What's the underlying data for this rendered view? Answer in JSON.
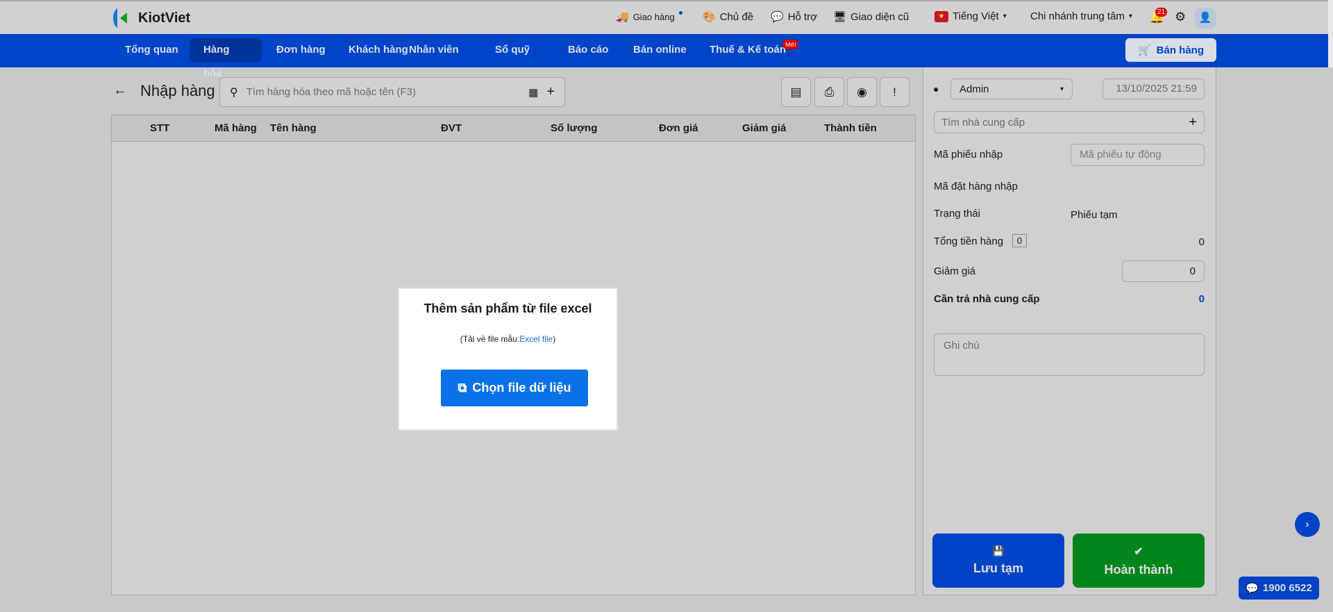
{
  "header": {
    "brand": "KiotViet",
    "delivery": "Giao hàng",
    "theme": "Chủ đề",
    "support": "Hỗ trợ",
    "old_ui": "Giao diện cũ",
    "language": "Tiếng Việt",
    "branch": "Chi nhánh trung tâm",
    "notification_count": "21"
  },
  "nav": {
    "items": [
      {
        "label": "Tổng quan"
      },
      {
        "label": "Hàng hóa"
      },
      {
        "label": "Đơn hàng"
      },
      {
        "label": "Khách hàng"
      },
      {
        "label": "Nhân viên"
      },
      {
        "label": "Sổ quỹ"
      },
      {
        "label": "Báo cáo"
      },
      {
        "label": "Bán online"
      },
      {
        "label": "Thuế & Kế toán"
      }
    ],
    "new_badge": "Mới",
    "sell_button": "Bán hàng"
  },
  "page": {
    "title": "Nhập hàng",
    "search_placeholder": "Tìm hàng hóa theo mã hoặc tên (F3)"
  },
  "table": {
    "columns": [
      "STT",
      "Mã hàng",
      "Tên hàng",
      "ĐVT",
      "Số lượng",
      "Đơn giá",
      "Giảm giá",
      "Thành tiền"
    ]
  },
  "import_dialog": {
    "title": "Thêm sản phẩm từ file excel",
    "hint_prefix": "(Tải về file mẫu:",
    "hint_link": "Excel file",
    "hint_suffix": ")",
    "button": "Chọn file dữ liệu"
  },
  "panel": {
    "user": "Admin",
    "datetime": "13/10/2025 21:59",
    "supplier_placeholder": "Tìm nhà cung cấp",
    "receipt_code_label": "Mã phiếu nhập",
    "receipt_code_placeholder": "Mã phiếu tự động",
    "order_code_label": "Mã đặt hàng nhập",
    "status_label": "Trạng thái",
    "status_value": "Phiếu tạm",
    "total_label": "Tổng tiền hàng",
    "total_count": "0",
    "total_value": "0",
    "discount_label": "Giảm giá",
    "discount_value": "0",
    "payable_label": "Cần trả nhà cung cấp",
    "payable_value": "0",
    "note_placeholder": "Ghi chú",
    "save_draft": "Lưu tạm",
    "complete": "Hoàn thành"
  },
  "hotline": "1900 6522",
  "colors": {
    "nav": "#0044c8",
    "green": "#00851a",
    "primary": "#0a72e8"
  }
}
